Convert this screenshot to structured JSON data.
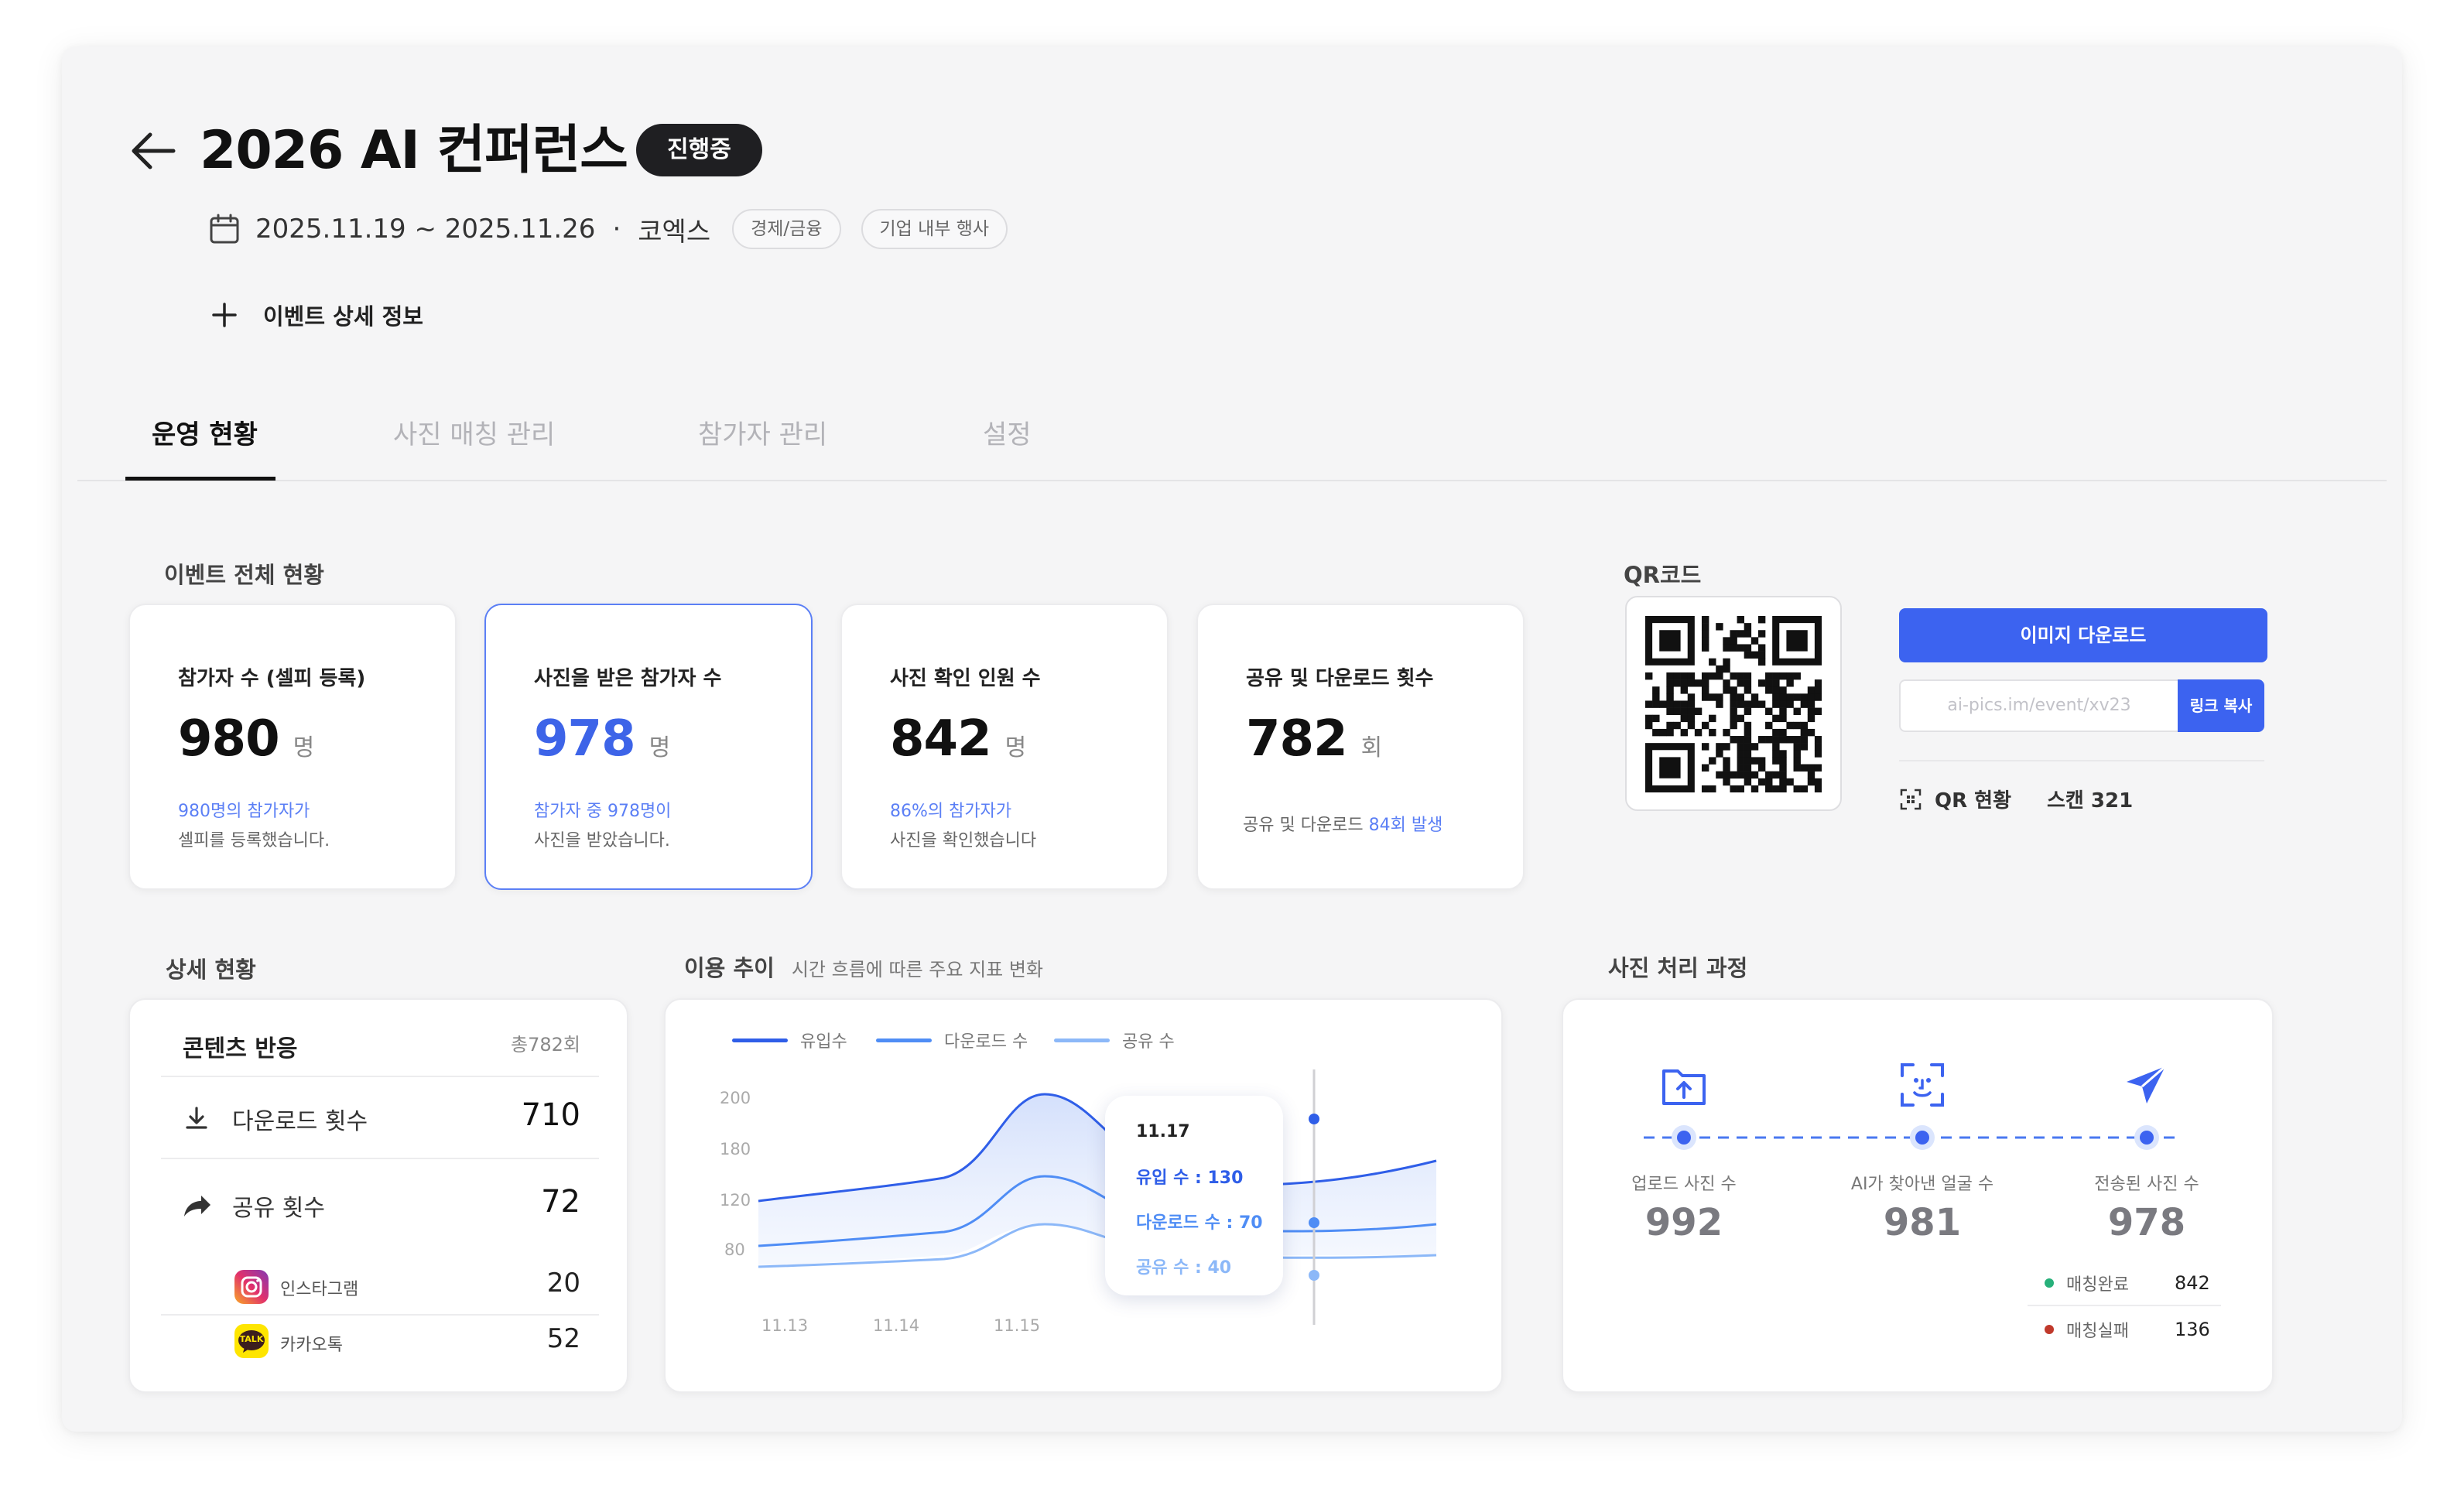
{
  "header": {
    "title": "2026 AI 컨퍼런스",
    "status": "진행중",
    "date_range": "2025.11.19 ~ 2025.11.26",
    "separator": "·",
    "venue": "코엑스",
    "tags": [
      "경제/금융",
      "기업 내부 행사"
    ],
    "detail_link": "이벤트 상세 정보"
  },
  "tabs": [
    "운영 현황",
    "사진 매칭 관리",
    "참가자 관리",
    "설정"
  ],
  "active_tab": 0,
  "overview": {
    "label": "이벤트 전체 현황",
    "cards": [
      {
        "label": "참가자 수 (셀피 등록)",
        "value": "980",
        "unit": "명",
        "note1": "980명의 참가자가",
        "note2": "셀피를 등록했습니다."
      },
      {
        "label": "사진을 받은 참가자 수",
        "value": "978",
        "unit": "명",
        "note1": "참가자 중 978명이",
        "note2": "사진을 받았습니다."
      },
      {
        "label": "사진 확인 인원 수",
        "value": "842",
        "unit": "명",
        "note1": "86%의 참가자가",
        "note2": "사진을 확인했습니다"
      },
      {
        "label": "공유 및 다운로드 횟수",
        "value": "782",
        "unit": "회",
        "note_prefix": "공유 및 다운로드 ",
        "note_highlight": "84회 발생"
      }
    ]
  },
  "qr": {
    "label": "QR코드",
    "download_button": "이미지 다운로드",
    "link": "ai-pics.im/event/xv23",
    "copy_button": "링크 복사",
    "status_label": "QR 현황",
    "scan_text": "스캔 321"
  },
  "detail": {
    "label": "상세 현황",
    "title": "콘텐츠 반응",
    "total": "총782회",
    "rows": [
      {
        "label": "다운로드 횟수",
        "value": "710"
      },
      {
        "label": "공유 횟수",
        "value": "72"
      }
    ],
    "sub_rows": [
      {
        "label": "인스타그램",
        "value": "20"
      },
      {
        "label": "카카오톡",
        "value": "52"
      }
    ],
    "kakao_badge": "TALK"
  },
  "trend": {
    "label": "이용 추이",
    "subtitle": "시간 흐름에 따른 주요 지표 변화",
    "tooltip": {
      "date": "11.17",
      "inflow": "유입 수 : 130",
      "download": "다운로드 수 : 70",
      "share": "공유 수 : 40"
    }
  },
  "chart_data": {
    "type": "area",
    "title": "",
    "xlabel": "",
    "ylabel": "",
    "y_ticks": [
      "200",
      "180",
      "120",
      "80"
    ],
    "x_ticks": [
      "11.13",
      "11.14",
      "11.15"
    ],
    "series": [
      {
        "name": "유입수",
        "color": "#2f5ee8"
      },
      {
        "name": "다운로드 수",
        "color": "#4f8df5"
      },
      {
        "name": "공유 수",
        "color": "#8cb8f8"
      }
    ],
    "highlight_point": {
      "date": "11.17",
      "values": {
        "유입수": 130,
        "다운로드 수": 70,
        "공유 수": 40
      }
    }
  },
  "process": {
    "label": "사진 처리 과정",
    "steps": [
      {
        "label": "업로드 사진 수",
        "value": "992",
        "icon": "upload-folder-icon"
      },
      {
        "label": "AI가 찾아낸 얼굴 수",
        "value": "981",
        "icon": "face-scan-icon"
      },
      {
        "label": "전송된 사진 수",
        "value": "978",
        "icon": "send-icon"
      }
    ],
    "matches": [
      {
        "label": "매칭완료",
        "value": "842",
        "color": "#27b07a"
      },
      {
        "label": "매칭실패",
        "value": "136",
        "color": "#c0392b"
      }
    ]
  },
  "colors": {
    "accent": "#3c63f0",
    "status_bg": "#1f1f22"
  }
}
